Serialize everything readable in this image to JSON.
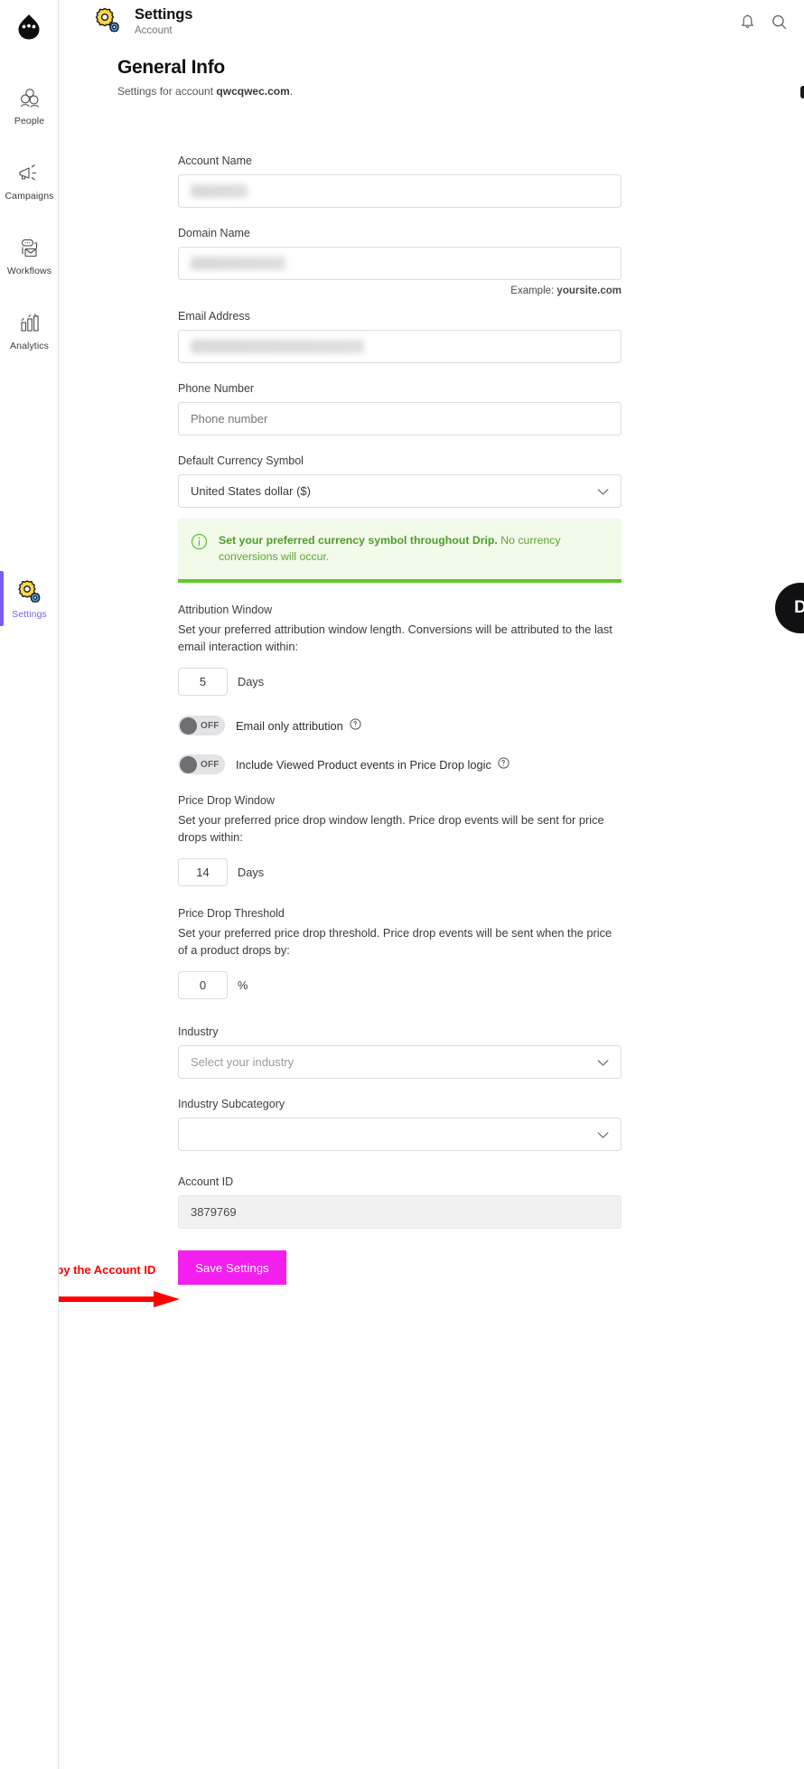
{
  "sidebar": {
    "logo_icon": "drip-face-logo",
    "items": [
      {
        "label": "People",
        "icon": "people-icon",
        "active": false
      },
      {
        "label": "Campaigns",
        "icon": "megaphone-icon",
        "active": false
      },
      {
        "label": "Workflows",
        "icon": "workflow-icon",
        "active": false
      },
      {
        "label": "Analytics",
        "icon": "bar-chart-icon",
        "active": false
      },
      {
        "label": "Settings",
        "icon": "gear-icon",
        "active": true
      }
    ],
    "active_color": "#7c5cf0"
  },
  "header": {
    "icon": "gear-icon",
    "title": "Settings",
    "subtitle": "Account",
    "bell_icon": "bell-icon",
    "search_icon": "search-icon"
  },
  "page": {
    "title": "General Info",
    "subtitle_prefix": "Settings for account ",
    "subtitle_domain": "qwcqwec.com",
    "subtitle_suffix": "."
  },
  "form": {
    "account_name": {
      "label": "Account Name",
      "value": "",
      "redacted": true
    },
    "domain_name": {
      "label": "Domain Name",
      "value": "",
      "redacted": true,
      "hint_prefix": "Example: ",
      "hint_value": "yoursite.com"
    },
    "email_address": {
      "label": "Email Address",
      "value": "",
      "redacted": true
    },
    "phone_number": {
      "label": "Phone Number",
      "value": "",
      "placeholder": "Phone number"
    },
    "currency": {
      "label": "Default Currency Symbol",
      "value": "United States dollar ($)",
      "chevron_icon": "chevron-down-icon"
    },
    "currency_banner": {
      "icon": "info-icon",
      "bold_text": "Set your preferred currency symbol throughout Drip.",
      "rest_text": " No currency conversions will occur.",
      "bg_color": "#f2faea",
      "accent_color": "#5ec927",
      "text_color": "#5aa632"
    },
    "attribution_window": {
      "title": "Attribution Window",
      "description": "Set your preferred attribution window length. Conversions will be attributed to the last email interaction within:",
      "value": "5",
      "unit": "Days"
    },
    "toggles": [
      {
        "state": "OFF",
        "label": "Email only attribution",
        "help_icon": "help-circle-icon"
      },
      {
        "state": "OFF",
        "label": "Include Viewed Product events in Price Drop logic",
        "help_icon": "help-circle-icon"
      }
    ],
    "price_drop_window": {
      "title": "Price Drop Window",
      "description": "Set your preferred price drop window length. Price drop events will be sent for price drops within:",
      "value": "14",
      "unit": "Days"
    },
    "price_drop_threshold": {
      "title": "Price Drop Threshold",
      "description": "Set your preferred price drop threshold. Price drop events will be sent when the price of a product drops by:",
      "value": "0",
      "unit": "%"
    },
    "industry": {
      "label": "Industry",
      "value": "",
      "placeholder": "Select your industry",
      "chevron_icon": "chevron-down-icon"
    },
    "industry_subcategory": {
      "label": "Industry Subcategory",
      "value": "",
      "placeholder": "",
      "chevron_icon": "chevron-down-icon"
    },
    "account_id": {
      "label": "Account ID",
      "value": "3879769",
      "readonly": true
    },
    "save_button": {
      "label": "Save Settings",
      "color": "#f31fef"
    }
  },
  "annotation": {
    "text": "Copy the Account ID",
    "color": "#ff0000",
    "arrow_icon": "right-arrow-icon"
  },
  "widgets": {
    "chat_bubble": {
      "label": "D",
      "bg_color": "#111114"
    }
  }
}
